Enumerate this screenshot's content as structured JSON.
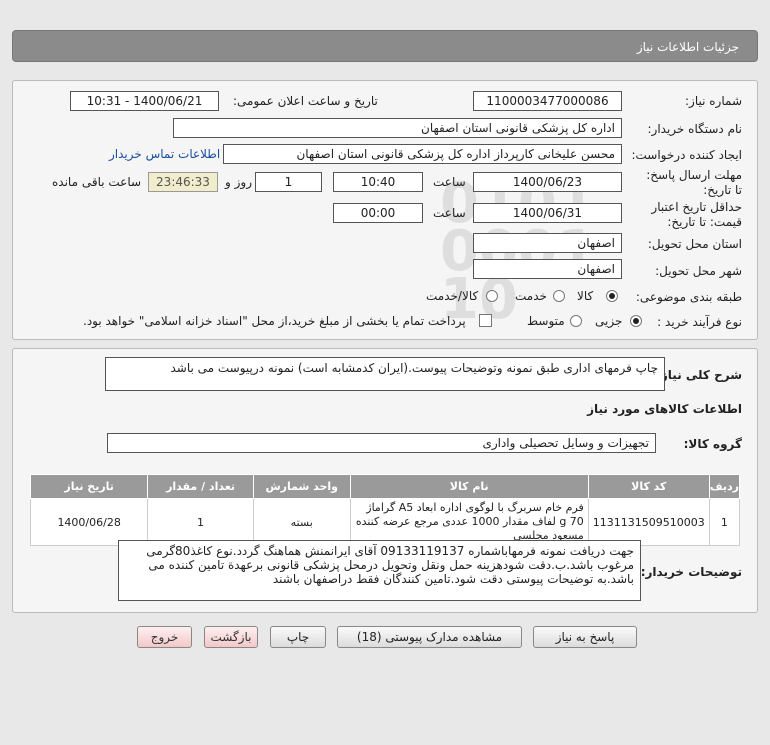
{
  "header": {
    "title": "جزئیات اطلاعات نیاز"
  },
  "info": {
    "need_number_label": "شماره نیاز:",
    "need_number": "1100003477000086",
    "announce_label": "تاریخ و ساعت اعلان عمومی:",
    "announce_value": "1400/06/21 - 10:31",
    "buyer_org_label": "نام دستگاه خریدار:",
    "buyer_org": "اداره کل پزشکی قانونی استان اصفهان",
    "creator_label": "ایجاد کننده درخواست:",
    "creator": "محسن علیخانی کارپرداز اداره کل پزشکی قانونی استان اصفهان",
    "contact_link": "اطلاعات تماس خریدار",
    "deadline_label": "مهلت ارسال پاسخ: تا تاریخ:",
    "deadline_date": "1400/06/23",
    "time_label": "ساعت",
    "deadline_time": "10:40",
    "days_value": "1",
    "days_label": "روز و",
    "remaining_time": "23:46:33",
    "remaining_label": "ساعت باقی مانده",
    "validity_label": "حداقل تاریخ اعتبار قیمت: تا تاریخ:",
    "validity_date": "1400/06/31",
    "validity_time_label": "ساعت",
    "validity_time": "00:00",
    "province_label": "استان محل تحویل:",
    "province": "اصفهان",
    "city_label": "شهر محل تحویل:",
    "city": "اصفهان",
    "category_label": "طبقه بندی موضوعی:",
    "category_options": [
      "کالا",
      "خدمت",
      "کالا/خدمت"
    ],
    "process_label": "نوع فرآیند خرید :",
    "process_options": [
      "جزیی",
      "متوسط"
    ],
    "payment_note": "پرداخت تمام یا بخشی از مبلغ خرید،از محل \"اسناد خزانه اسلامی\" خواهد بود."
  },
  "summary": {
    "label": "شرح کلی نیاز:",
    "text": "چاپ فرمهای اداری طبق نمونه وتوضیحات پیوست.(ایران کدمشابه است) نمونه درپیوست می باشد"
  },
  "goods": {
    "title": "اطلاعات کالاهای مورد نیاز",
    "group_label": "گروه کالا:",
    "group_value": "تجهیزات و وسایل تحصیلی واداری",
    "columns": [
      "ردیف",
      "کد کالا",
      "نام کالا",
      "واحد شمارش",
      "تعداد / مقدار",
      "تاریخ نیاز"
    ],
    "rows": [
      {
        "row": "1",
        "code": "1131131509510003",
        "name": "فرم خام سربرگ با لوگوی اداره ابعاد A5 گراماژ 70 g لفاف مقدار 1000 عددی مرجع عرضه کننده مسعود مجلسی",
        "unit": "بسته",
        "qty": "1",
        "date": "1400/06/28"
      }
    ]
  },
  "buyer_notes": {
    "label": "توضیحات خریدار:",
    "text": "جهت دریافت نمونه فرمهاباشماره 09133119137 آقای ایرانمنش هماهنگ گردد.نوع کاغذ80گرمی مرغوب باشد.ب.دقت شودهزینه حمل ونقل وتحویل درمحل پزشکی قانونی برعهدة تامین کننده می باشد.به توضیحات پیوستی دقت شود.تامین کنندگان فقط دراصفهان باشند"
  },
  "buttons": {
    "reply": "پاسخ به نیاز",
    "docs": "مشاهده مدارک پیوستی (18)",
    "print": "چاپ",
    "back": "بازگشت",
    "exit": "خروج"
  }
}
